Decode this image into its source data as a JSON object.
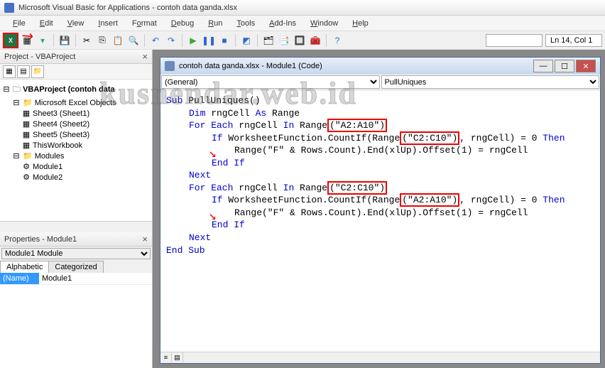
{
  "title": "Microsoft Visual Basic for Applications - contoh data ganda.xlsx",
  "menu": [
    "File",
    "Edit",
    "View",
    "Insert",
    "Format",
    "Debug",
    "Run",
    "Tools",
    "Add-Ins",
    "Window",
    "Help"
  ],
  "toolbar_status": {
    "pos": "Ln 14, Col 1"
  },
  "project_panel": {
    "title": "Project - VBAProject"
  },
  "tree": {
    "root": "VBAProject (contoh data",
    "group1": "Microsoft Excel Objects",
    "sheets": [
      "Sheet3 (Sheet1)",
      "Sheet4 (Sheet2)",
      "Sheet5 (Sheet3)"
    ],
    "wb": "ThisWorkbook",
    "group2": "Modules",
    "mods": [
      "Module1",
      "Module2"
    ]
  },
  "properties_panel": {
    "title": "Properties - Module1",
    "combo": "Module1 Module",
    "tab1": "Alphabetic",
    "tab2": "Categorized",
    "name_key": "(Name)",
    "name_val": "Module1"
  },
  "code_window": {
    "title": "contoh data ganda.xlsx - Module1 (Code)",
    "combo_left": "(General)",
    "combo_right": "PullUniques"
  },
  "code": {
    "l1a": "Sub",
    "l1b": " PullUniques()",
    "l2a": "Dim",
    "l2b": " rngCell ",
    "l2c": "As",
    "l2d": " Range",
    "l3a": "For Each",
    "l3b": " rngCell ",
    "l3c": "In",
    "l3d": " Range",
    "l3e": "(\"A2:A10\")",
    "l4a": "If",
    "l4b": " WorksheetFunction.CountIf(Range",
    "l4c": "(\"C2:C10\")",
    "l4d": ", rngCell) = 0 ",
    "l4e": "Then",
    "l5": "Range(\"F\" & Rows.Count).End(xlUp).Offset(1) = rngCell",
    "l6": "End If",
    "l7": "Next",
    "l8a": "For Each",
    "l8b": " rngCell ",
    "l8c": "In",
    "l8d": " Range",
    "l8e": "(\"C2:C10\")",
    "l9a": "If",
    "l9b": " WorksheetFunction.CountIf(Range",
    "l9c": "(\"A2:A10\")",
    "l9d": ", rngCell) = 0 ",
    "l9e": "Then",
    "l10": "Range(\"F\" & Rows.Count).End(xlUp).Offset(1) = rngCell",
    "l11": "End If",
    "l12": "Next",
    "l13": "End Sub"
  },
  "watermark": "kusnendar.web.id"
}
